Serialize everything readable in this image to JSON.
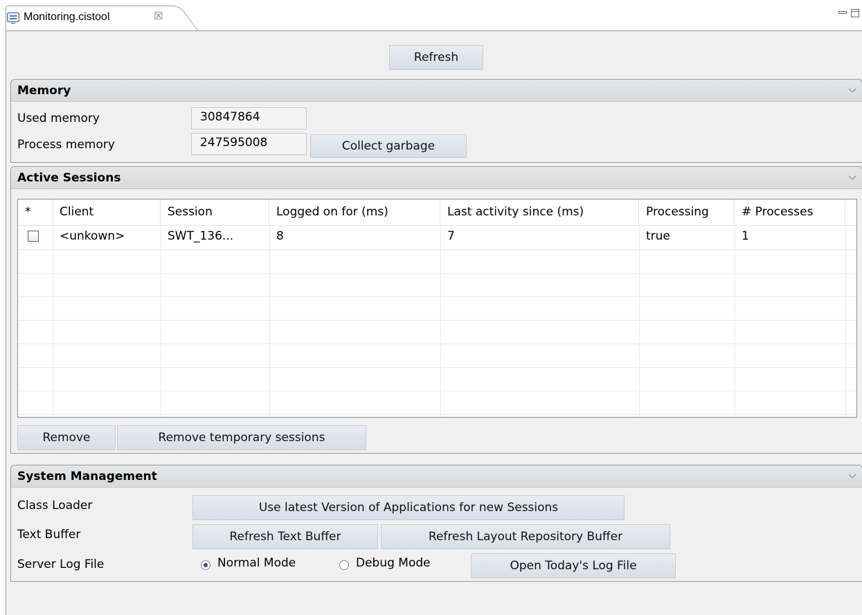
{
  "tab": {
    "title": "Monitoring.cistool",
    "close_glyph": "☒"
  },
  "toolbar": {
    "refresh_label": "Refresh"
  },
  "memory": {
    "title": "Memory",
    "used_label": "Used memory",
    "used_value": "30847864",
    "process_label": "Process memory",
    "process_value": "247595008",
    "collect_label": "Collect garbage"
  },
  "sessions": {
    "title": "Active Sessions",
    "columns": [
      "*",
      "Client",
      "Session",
      "Logged on for (ms)",
      "Last activity since (ms)",
      "Processing",
      "# Processes"
    ],
    "rows": [
      {
        "selected": false,
        "client": "<unkown>",
        "session": "SWT_136...",
        "logged_on": "8",
        "last_activity": "7",
        "processing": "true",
        "processes": "1"
      }
    ],
    "remove_label": "Remove",
    "remove_temp_label": "Remove temporary sessions"
  },
  "system": {
    "title": "System Management",
    "class_loader_label": "Class Loader",
    "class_loader_button": "Use latest Version of Applications for new Sessions",
    "text_buffer_label": "Text Buffer",
    "refresh_text_button": "Refresh Text Buffer",
    "refresh_layout_button": "Refresh Layout Repository Buffer",
    "log_label": "Server Log File",
    "normal_mode_label": "Normal Mode",
    "debug_mode_label": "Debug Mode",
    "selected_mode": "Normal Mode",
    "open_log_button": "Open Today's Log File"
  },
  "icons": {
    "tab": "editor-icon",
    "close": "close-icon",
    "minimize": "minimize-icon",
    "maximize": "maximize-icon",
    "collapse": "collapse-twisty-icon"
  }
}
